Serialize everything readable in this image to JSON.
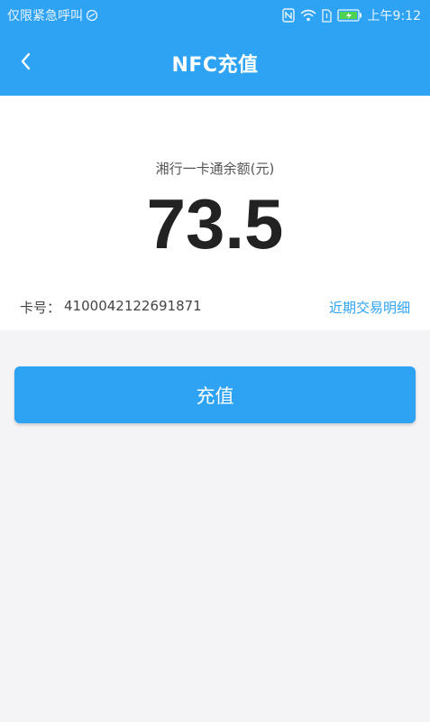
{
  "status_bar": {
    "left_text": "仅限紧急呼叫",
    "time": "上午9:12"
  },
  "header": {
    "title": "NFC充值"
  },
  "balance": {
    "label": "湘行一卡通余额(元)",
    "value": "73.5"
  },
  "card": {
    "number_label": "卡号：",
    "number": "4100042122691871",
    "detail_link": "近期交易明细"
  },
  "actions": {
    "recharge_label": "充值"
  },
  "colors": {
    "primary": "#2ea3f4",
    "background": "#f4f4f6",
    "text_dark": "#222222"
  },
  "icons": {
    "back": "chevron-left-icon",
    "nfc": "nfc-icon",
    "wifi": "wifi-icon",
    "battery": "battery-icon",
    "sim": "sim-icon"
  }
}
